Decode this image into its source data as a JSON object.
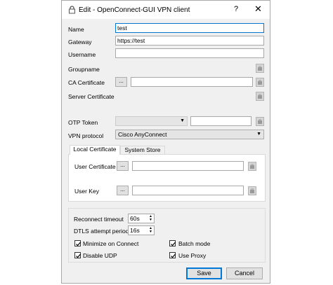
{
  "window": {
    "title": "Edit - OpenConnect-GUI VPN client",
    "help_glyph": "?",
    "close_glyph": "✕"
  },
  "form": {
    "name_label": "Name",
    "name_value": "test",
    "gateway_label": "Gateway",
    "gateway_value": "https://test",
    "username_label": "Username",
    "username_value": "",
    "groupname_label": "Groupname",
    "ca_cert_label": "CA Certificate",
    "ca_cert_value": "",
    "server_cert_label": "Server Certificate",
    "otp_label": "OTP Token",
    "otp_value": "",
    "vpn_protocol_label": "VPN protocol",
    "vpn_protocol_value": "Cisco AnyConnect",
    "browse_label": "..."
  },
  "tabs": [
    {
      "label": "Local Certificate",
      "active": true
    },
    {
      "label": "System Store",
      "active": false
    }
  ],
  "local_cert": {
    "user_cert_label": "User Certificate",
    "user_cert_value": "",
    "user_key_label": "User Key",
    "user_key_value": ""
  },
  "options": {
    "reconnect_label": "Reconnect timeout",
    "reconnect_value": "60s",
    "dtls_label": "DTLS attempt period",
    "dtls_value": "16s",
    "minimize_label": "Minimize on Connect",
    "minimize_checked": true,
    "batch_label": "Batch mode",
    "batch_checked": true,
    "disable_udp_label": "Disable UDP",
    "disable_udp_checked": true,
    "use_proxy_label": "Use Proxy",
    "use_proxy_checked": true
  },
  "buttons": {
    "save_label": "Save",
    "cancel_label": "Cancel"
  },
  "icons": {
    "window_icon": "lock-icon",
    "clear_icon": "clear-icon"
  },
  "colors": {
    "focus_border": "#0078d7",
    "window_bg": "#f0f0f0"
  }
}
